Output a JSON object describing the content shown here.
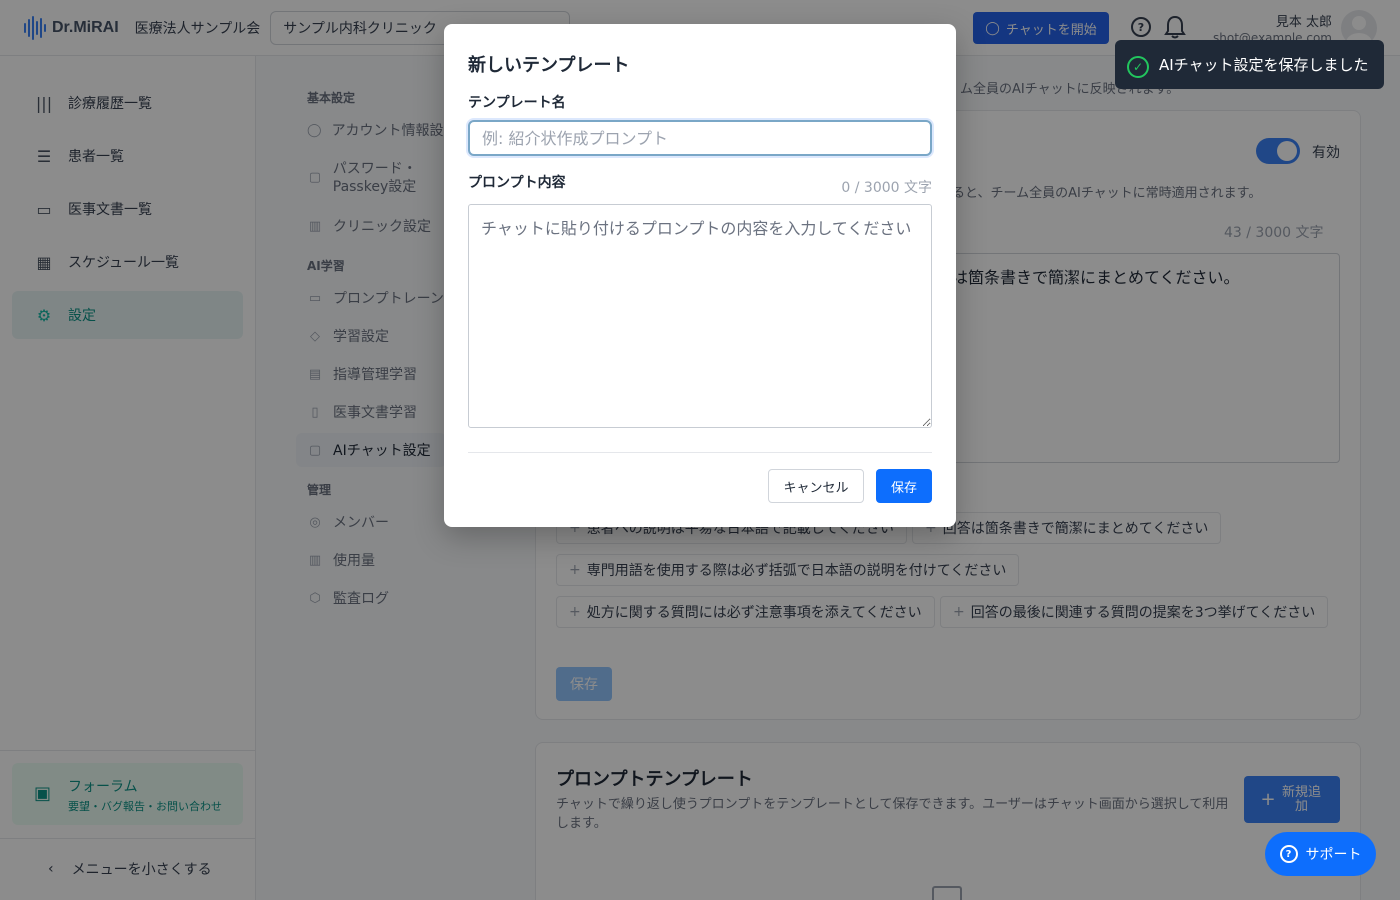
{
  "header": {
    "logo_text": "Dr.MiRAI",
    "org_name": "医療法人サンプル会",
    "clinic_select_value": "サンプル内科クリニック",
    "chat_start_label": "チャットを開始",
    "user_name": "見本 太郎",
    "user_email": "shot@example.com"
  },
  "sidebar": {
    "items": [
      {
        "label": "診療履歴一覧",
        "icon": "waveform-icon"
      },
      {
        "label": "患者一覧",
        "icon": "patient-list-icon"
      },
      {
        "label": "医事文書一覧",
        "icon": "document-icon"
      },
      {
        "label": "スケジュール一覧",
        "icon": "calendar-icon"
      },
      {
        "label": "設定",
        "icon": "gear-icon",
        "active": true
      }
    ],
    "forum_title": "フォーラム",
    "forum_subtitle": "要望・バグ報告・お問い合わせ",
    "collapse_label": "メニューを小さくする"
  },
  "settings_nav": {
    "section_basic": "基本設定",
    "basic_items": [
      "アカウント情報設定",
      "パスワード・Passkey設定",
      "クリニック設定"
    ],
    "section_ai": "AI学習",
    "ai_items": [
      "プロンプトレーン",
      "学習設定",
      "指導管理学習",
      "医事文書学習",
      "AIチャット設定"
    ],
    "section_admin": "管理",
    "admin_items": [
      "メンバー",
      "使用量",
      "監査ログ"
    ]
  },
  "main": {
    "desc_text": "ム全員のAIチャットに反映されます。",
    "toggle_label": "有効",
    "system_desc": "ると、チーム全員のAIチャットに常時適用されます。",
    "system_count": "43 / 3000 文字",
    "system_text": "は箇条書きで簡潔にまとめてください。",
    "chips": [
      "患者への説明は平易な日本語で記載してください",
      "回答は箇条書きで簡潔にまとめてください",
      "専門用語を使用する際は必ず括弧で日本語の説明を付けてください",
      "処方に関する質問には必ず注意事項を添えてください",
      "回答の最後に関連する質問の提案を3つ挙げてください"
    ],
    "save_label": "保存",
    "template_title": "プロンプトテンプレート",
    "template_desc": "チャットで繰り返し使うプロンプトをテンプレートとして保存できます。ユーザーはチャット画面から選択して利用します。",
    "add_new_label": "新規追加"
  },
  "modal": {
    "title": "新しいテンプレート",
    "name_label": "テンプレート名",
    "name_placeholder": "例: 紹介状作成プロンプト",
    "name_value": "",
    "content_label": "プロンプト内容",
    "char_count": "0 / 3000 文字",
    "content_placeholder": "チャットに貼り付けるプロンプトの内容を入力してください",
    "content_value": "",
    "cancel_label": "キャンセル",
    "save_label": "保存"
  },
  "toast": {
    "message": "AIチャット設定を保存しました"
  },
  "support": {
    "label": "サポート"
  },
  "colors": {
    "primary": "#0d6efd",
    "accent_teal": "#0d9488",
    "toast_bg": "#1f2937",
    "success": "#22c55e"
  }
}
